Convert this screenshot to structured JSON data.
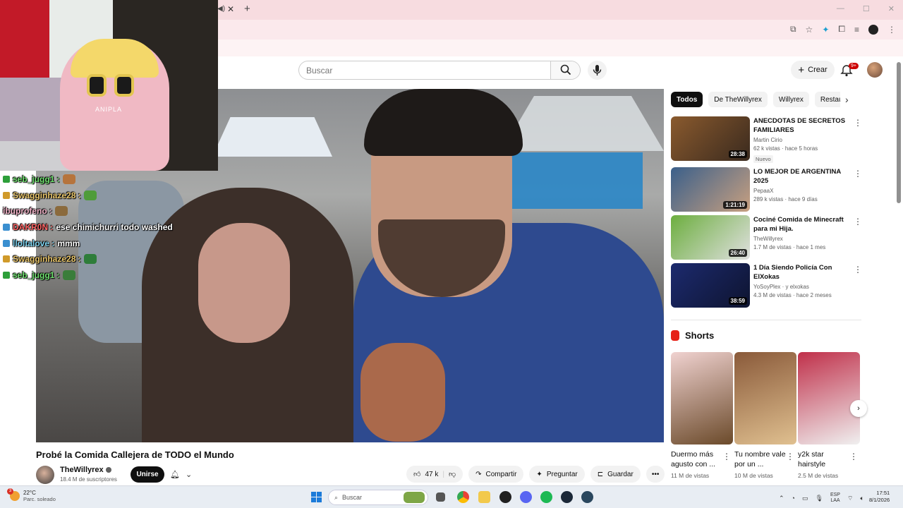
{
  "masthead": {
    "search_placeholder": "Buscar",
    "create_label": "Crear",
    "notif_badge": "9+"
  },
  "chat": [
    {
      "user": "seb_jugg1 :",
      "text": "",
      "color": "green",
      "badge": "#2d9f3a",
      "emote": "#b6743c"
    },
    {
      "user": "Swagginhaze28 :",
      "text": "",
      "color": "gold",
      "badge": "#d09a2a",
      "emote": "#4f9c3a"
    },
    {
      "user": "ibuprofeno :",
      "text": "",
      "color": "pink",
      "badge": "",
      "emote": "#8b6a3c"
    },
    {
      "user": "DAKR0N :",
      "text": "ese chimichurri todo washed",
      "color": "red",
      "badge": "#3a8fd0",
      "emote": ""
    },
    {
      "user": "lloltalove :",
      "text": "mmm",
      "color": "blue",
      "badge": "#3a8fd0",
      "emote": ""
    },
    {
      "user": "Swagginhaze28 :",
      "text": "",
      "color": "gold",
      "badge": "#d09a2a",
      "emote": "#2e7d3a"
    },
    {
      "user": "seb_jugg1 :",
      "text": "",
      "color": "green",
      "badge": "#2d9f3a",
      "emote": "#3a7d3a"
    }
  ],
  "video": {
    "title": "Probé la Comida Callejera de TODO el Mundo",
    "channel": "TheWillyrex",
    "subscribers": "18.4 M de suscriptores",
    "join_label": "Unirse",
    "likes": "47 k",
    "share_label": "Compartir",
    "ask_label": "Preguntar",
    "save_label": "Guardar"
  },
  "chips": [
    "Todos",
    "De TheWillyrex",
    "Willyrex",
    "Restaurantes"
  ],
  "recommendations": [
    {
      "title": "ANECDOTAS DE SECRETOS FAMILIARES",
      "channel": "Martin Cirio",
      "meta": "62 k vistas · hace 5 horas",
      "duration": "28:38",
      "badge": "Nuevo",
      "color1": "#8a5a2e",
      "color2": "#3a2a1e"
    },
    {
      "title": "LO MEJOR DE ARGENTINA 2025",
      "channel": "PepaaX",
      "meta": "289 k vistas · hace 9 días",
      "duration": "1:21:19",
      "badge": "",
      "color1": "#3a5f8a",
      "color2": "#c8a080"
    },
    {
      "title": "Cociné Comida de Minecraft para mi Hija.",
      "channel": "TheWillyrex",
      "meta": "1.7 M de vistas · hace 1 mes",
      "duration": "26:40",
      "badge": "",
      "color1": "#6cae3e",
      "color2": "#e0e0e0"
    },
    {
      "title": "1 Día Siendo Policía Con ElXokas",
      "channel": "YoSoyPlex · y elxokas",
      "meta": "4.3 M de vistas · hace 2 meses",
      "duration": "38:59",
      "badge": "",
      "color1": "#1c2a6e",
      "color2": "#0e1430"
    }
  ],
  "shorts": {
    "heading": "Shorts",
    "items": [
      {
        "title": "Duermo más agusto con ...",
        "views": "11 M de vistas",
        "color1": "#f0d2d0",
        "color2": "#6b4a2a"
      },
      {
        "title": "Tu nombre vale por un ...",
        "views": "10 M de vistas",
        "color1": "#8a5a3a",
        "color2": "#e0c090"
      },
      {
        "title": "y2k star hairstyle",
        "views": "2.5 M de vistas",
        "color1": "#c0304a",
        "color2": "#f0f0f0"
      }
    ]
  },
  "taskbar": {
    "temp": "22°C",
    "weather": "Parc. soleado",
    "weather_badge": "3",
    "search": "Buscar",
    "lang1": "ESP",
    "lang2": "LAA",
    "time": "17:51",
    "date": "8/1/2026"
  }
}
